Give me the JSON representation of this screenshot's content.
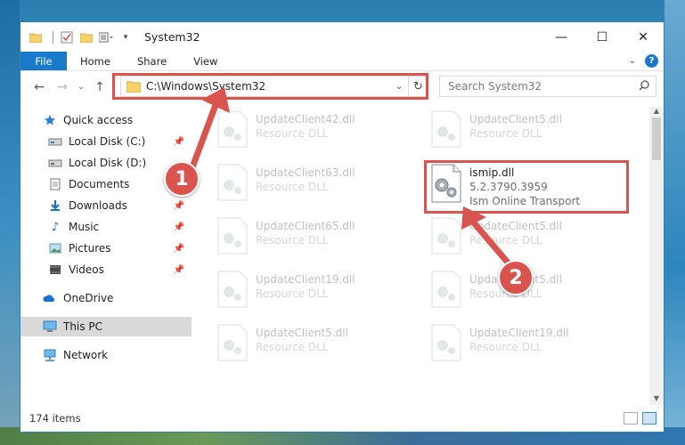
{
  "titlebar": {
    "title": "System32",
    "minimize": "—",
    "maximize": "☐",
    "close": "✕"
  },
  "ribbon": {
    "file": "File",
    "home": "Home",
    "share": "Share",
    "view": "View",
    "help": "?"
  },
  "nav": {
    "address": "C:\\Windows\\System32",
    "search_placeholder": "Search System32"
  },
  "sidebar": {
    "items": [
      {
        "label": "Quick access",
        "icon": "star-icon",
        "pinned": false
      },
      {
        "label": "Local Disk (C:)",
        "icon": "drive-icon",
        "pinned": true
      },
      {
        "label": "Local Disk (D:)",
        "icon": "drive-icon",
        "pinned": false
      },
      {
        "label": "Documents",
        "icon": "documents-icon",
        "pinned": true
      },
      {
        "label": "Downloads",
        "icon": "downloads-icon",
        "pinned": true
      },
      {
        "label": "Music",
        "icon": "music-icon",
        "pinned": true
      },
      {
        "label": "Pictures",
        "icon": "pictures-icon",
        "pinned": true
      },
      {
        "label": "Videos",
        "icon": "videos-icon",
        "pinned": true
      },
      {
        "label": "OneDrive",
        "icon": "onedrive-icon",
        "pinned": false
      },
      {
        "label": "This PC",
        "icon": "this-pc-icon",
        "pinned": false
      },
      {
        "label": "Network",
        "icon": "network-icon",
        "pinned": false
      }
    ]
  },
  "files": [
    {
      "name": "UpdateClient42.dll",
      "sub": "Resource DLL"
    },
    {
      "name": "UpdateClient5.dll",
      "sub": "Resource DLL"
    },
    {
      "name": "UpdateClient63.dll",
      "sub": "Resource DLL"
    },
    {
      "name": "ismip.dll",
      "version": "5.2.3790.3959",
      "sub": "Ism Online Transport"
    },
    {
      "name": "UpdateClient65.dll",
      "sub": "Resource DLL"
    },
    {
      "name": "UpdateClient5.dll",
      "sub": "Resource DLL"
    },
    {
      "name": "UpdateClient19.dll",
      "sub": "Resource DLL"
    },
    {
      "name": "UpdateClient5.dll",
      "sub": "Resource DLL"
    },
    {
      "name": "UpdateClient5.dll",
      "sub": "Resource DLL"
    },
    {
      "name": "UpdateClient19.dll",
      "sub": "Resource DLL"
    }
  ],
  "status": {
    "count": "174 items"
  },
  "annotations": {
    "step1": "1",
    "step2": "2",
    "color": "#d9534f"
  }
}
